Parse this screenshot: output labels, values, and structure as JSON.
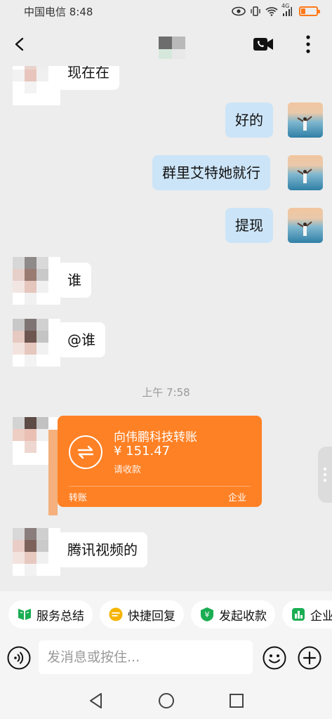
{
  "status_bar": {
    "carrier_time": "中国电信 8:48",
    "network": "4G"
  },
  "nav": {
    "accent": "#111111"
  },
  "messages": [
    {
      "side": "theirs",
      "text": "现在在"
    },
    {
      "side": "mine",
      "text": "好的"
    },
    {
      "side": "mine",
      "text": "群里艾特她就行"
    },
    {
      "side": "mine",
      "text": "提现"
    },
    {
      "side": "theirs",
      "text": "谁"
    },
    {
      "side": "theirs",
      "text": "@谁"
    }
  ],
  "timestamp": "上午 7:58",
  "transfer": {
    "title": "向伟鹏科技转账",
    "amount": "¥ 151.47",
    "status": "请收款",
    "type_label": "转账",
    "source_label": "企业",
    "color": "#ff8125"
  },
  "last_message": "腾讯视频的",
  "quick_actions": [
    {
      "label": "服务总结",
      "icon": "summary-icon"
    },
    {
      "label": "快捷回复",
      "icon": "quick-reply-icon"
    },
    {
      "label": "发起收款",
      "icon": "collect-payment-icon"
    },
    {
      "label": "企业",
      "icon": "enterprise-icon"
    }
  ],
  "input": {
    "placeholder": "发消息或按住..."
  }
}
